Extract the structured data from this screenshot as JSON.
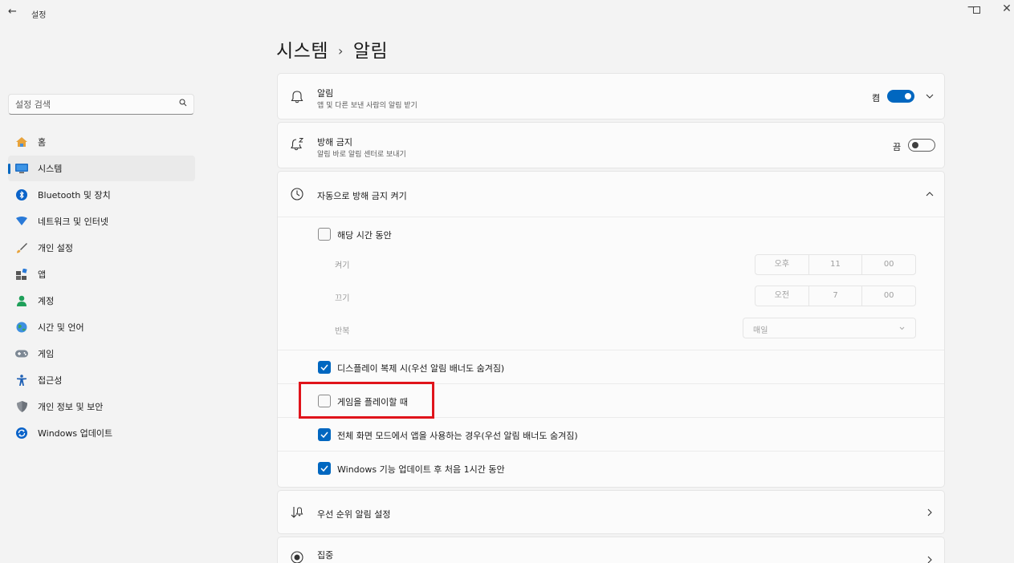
{
  "window": {
    "back_glyph": "←",
    "app_title": "설정",
    "min_glyph": "−",
    "close_glyph": "✕"
  },
  "sidebar": {
    "search_placeholder": "설정 검색",
    "items": [
      {
        "label": "홈",
        "icon": "home-icon"
      },
      {
        "label": "시스템",
        "icon": "system-icon",
        "active": true
      },
      {
        "label": "Bluetooth 및 장치",
        "icon": "bluetooth-icon"
      },
      {
        "label": "네트워크 및 인터넷",
        "icon": "network-icon"
      },
      {
        "label": "개인 설정",
        "icon": "brush-icon"
      },
      {
        "label": "앱",
        "icon": "apps-icon"
      },
      {
        "label": "계정",
        "icon": "account-icon"
      },
      {
        "label": "시간 및 언어",
        "icon": "globe-icon"
      },
      {
        "label": "게임",
        "icon": "gamepad-icon"
      },
      {
        "label": "접근성",
        "icon": "accessibility-icon"
      },
      {
        "label": "개인 정보 및 보안",
        "icon": "shield-icon"
      },
      {
        "label": "Windows 업데이트",
        "icon": "update-icon"
      }
    ]
  },
  "header": {
    "crumb_parent": "시스템",
    "crumb_sep": "›",
    "crumb_current": "알림"
  },
  "notifications": {
    "title": "알림",
    "subtitle": "앱 및 다른 보낸 사람의 알림 받기",
    "toggle_label": "켬",
    "toggle_on": true
  },
  "dnd": {
    "title": "방해 금지",
    "subtitle": "알림 바로 알림 센터로 보내기",
    "toggle_label": "끔",
    "toggle_on": false
  },
  "auto_dnd": {
    "title": "자동으로 방해 금지 켜기",
    "during_hours": {
      "label": "해당 시간 동안",
      "checked": false
    },
    "turn_on": {
      "label": "켜기",
      "ampm": "오후",
      "hour": "11",
      "minute": "00"
    },
    "turn_off": {
      "label": "끄기",
      "ampm": "오전",
      "hour": "7",
      "minute": "00"
    },
    "repeat": {
      "label": "반복",
      "value": "매일"
    },
    "options": [
      {
        "label": "디스플레이 복제 시(우선 알림 배너도 숨겨짐)",
        "checked": true
      },
      {
        "label": "게임을 플레이할 때",
        "checked": false
      },
      {
        "label": "전체 화면 모드에서 앱을 사용하는 경우(우선 알림 배너도 숨겨짐)",
        "checked": true
      },
      {
        "label": "Windows 기능 업데이트 후 처음 1시간 동안",
        "checked": true
      }
    ]
  },
  "priority": {
    "title": "우선 순위 알림 설정"
  },
  "focus": {
    "title": "집중"
  },
  "colors": {
    "accent": "#0067c0",
    "highlight": "#e0141b"
  }
}
